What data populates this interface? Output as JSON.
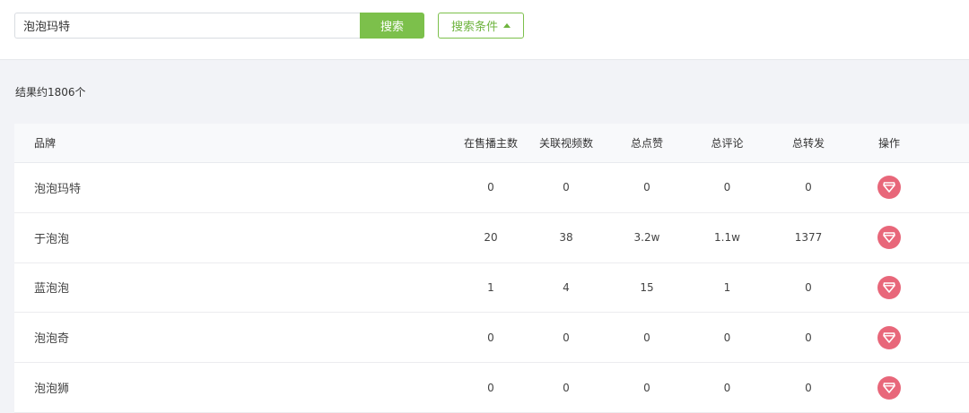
{
  "search": {
    "value": "泡泡玛特",
    "button_label": "搜索",
    "conditions_label": "搜索条件"
  },
  "result_count": "结果约1806个",
  "table": {
    "headers": {
      "brand": "品牌",
      "sellers": "在售播主数",
      "videos": "关联视频数",
      "likes": "总点赞",
      "comments": "总评论",
      "shares": "总转发",
      "action": "操作"
    },
    "rows": [
      {
        "brand": "泡泡玛特",
        "sellers": "0",
        "videos": "0",
        "likes": "0",
        "comments": "0",
        "shares": "0"
      },
      {
        "brand": "于泡泡",
        "sellers": "20",
        "videos": "38",
        "likes": "3.2w",
        "comments": "1.1w",
        "shares": "1377"
      },
      {
        "brand": "蓝泡泡",
        "sellers": "1",
        "videos": "4",
        "likes": "15",
        "comments": "1",
        "shares": "0"
      },
      {
        "brand": "泡泡奇",
        "sellers": "0",
        "videos": "0",
        "likes": "0",
        "comments": "0",
        "shares": "0"
      },
      {
        "brand": "泡泡狮",
        "sellers": "0",
        "videos": "0",
        "likes": "0",
        "comments": "0",
        "shares": "0"
      }
    ]
  },
  "icons": {
    "action": "diamond-icon",
    "conditions_toggle": "caret-up-icon"
  },
  "colors": {
    "accent_green": "#7cc04b",
    "action_red": "#e8677a",
    "page_bg": "#f2f3f7"
  }
}
